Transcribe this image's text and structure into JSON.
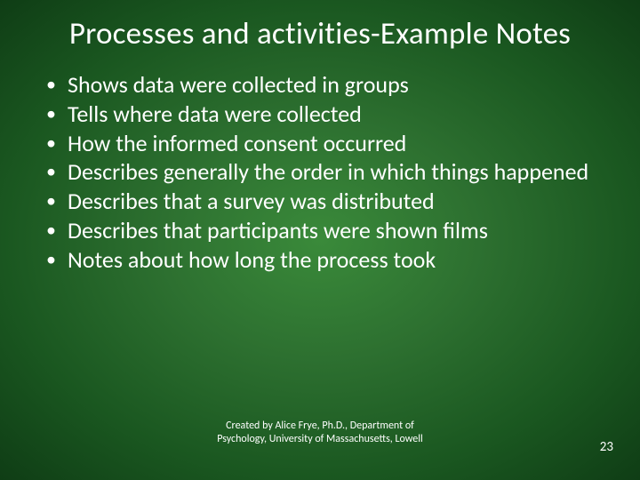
{
  "title": "Processes and activities-Example Notes",
  "bullets": [
    "Shows data were collected in groups",
    "Tells where data were collected",
    "How the informed consent occurred",
    "Describes generally the order in which things happened",
    "Describes that a survey was distributed",
    "Describes that participants were shown films",
    "Notes about how long the process took"
  ],
  "credit": "Created by Alice Frye, Ph.D., Department of Psychology, University of Massachusetts, Lowell",
  "page_number": "23"
}
